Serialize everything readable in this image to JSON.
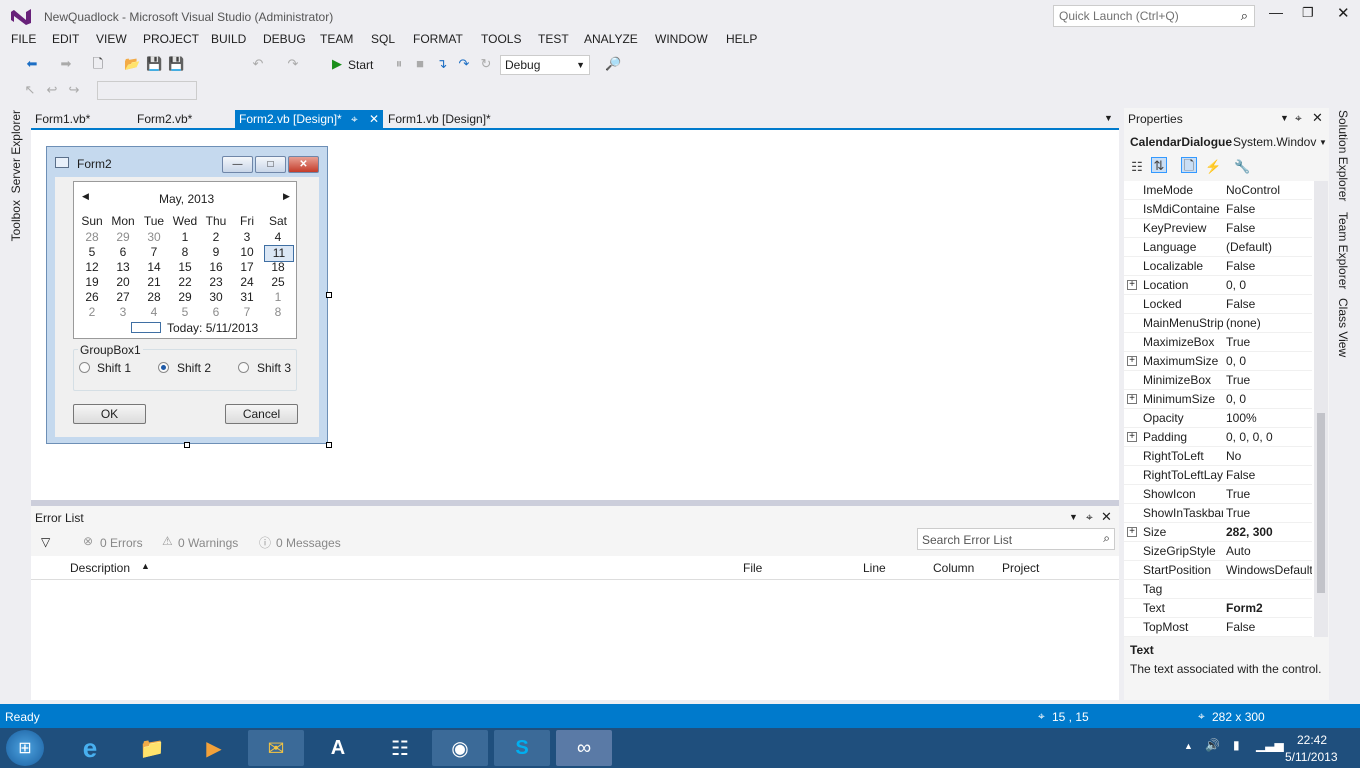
{
  "window": {
    "title": "NewQuadlock - Microsoft Visual Studio (Administrator)",
    "quick_launch_placeholder": "Quick Launch (Ctrl+Q)"
  },
  "menu": [
    "FILE",
    "EDIT",
    "VIEW",
    "PROJECT",
    "BUILD",
    "DEBUG",
    "TEAM",
    "SQL",
    "FORMAT",
    "TOOLS",
    "TEST",
    "ANALYZE",
    "WINDOW",
    "HELP"
  ],
  "toolbar": {
    "start_label": "Start",
    "config": "Debug"
  },
  "side_tabs": {
    "left": [
      "Server Explorer",
      "Toolbox"
    ],
    "right": [
      "Solution Explorer",
      "Team Explorer",
      "Class View"
    ]
  },
  "doc_tabs": [
    "Form1.vb*",
    "Form2.vb*",
    "Form2.vb [Design]*",
    "Form1.vb [Design]*"
  ],
  "form": {
    "title": "Form2",
    "calendar": {
      "month_label": "May, 2013",
      "day_headers": [
        "Sun",
        "Mon",
        "Tue",
        "Wed",
        "Thu",
        "Fri",
        "Sat"
      ],
      "weeks": [
        [
          "28",
          "29",
          "30",
          "1",
          "2",
          "3",
          "4"
        ],
        [
          "5",
          "6",
          "7",
          "8",
          "9",
          "10",
          "11"
        ],
        [
          "12",
          "13",
          "14",
          "15",
          "16",
          "17",
          "18"
        ],
        [
          "19",
          "20",
          "21",
          "22",
          "23",
          "24",
          "25"
        ],
        [
          "26",
          "27",
          "28",
          "29",
          "30",
          "31",
          "1"
        ],
        [
          "2",
          "3",
          "4",
          "5",
          "6",
          "7",
          "8"
        ]
      ],
      "today_label": "Today: 5/11/2013"
    },
    "groupbox": {
      "title": "GroupBox1",
      "options": [
        "Shift 1",
        "Shift 2",
        "Shift 3"
      ],
      "selected": "Shift 2"
    },
    "ok_label": "OK",
    "cancel_label": "Cancel"
  },
  "error_list": {
    "title": "Error List",
    "errors": "0 Errors",
    "warnings": "0 Warnings",
    "messages": "0 Messages",
    "search_placeholder": "Search Error List",
    "columns": [
      "Description",
      "File",
      "Line",
      "Column",
      "Project"
    ]
  },
  "properties": {
    "title": "Properties",
    "object": "CalendarDialogue",
    "type": "System.Windov",
    "rows": [
      {
        "name": "ImeMode",
        "value": "NoControl",
        "expandable": false,
        "bold": false
      },
      {
        "name": "IsMdiContaine",
        "value": "False",
        "expandable": false,
        "bold": false
      },
      {
        "name": "KeyPreview",
        "value": "False",
        "expandable": false,
        "bold": false
      },
      {
        "name": "Language",
        "value": "(Default)",
        "expandable": false,
        "bold": false
      },
      {
        "name": "Localizable",
        "value": "False",
        "expandable": false,
        "bold": false
      },
      {
        "name": "Location",
        "value": "0, 0",
        "expandable": true,
        "bold": false
      },
      {
        "name": "Locked",
        "value": "False",
        "expandable": false,
        "bold": false
      },
      {
        "name": "MainMenuStrip",
        "value": "(none)",
        "expandable": false,
        "bold": false
      },
      {
        "name": "MaximizeBox",
        "value": "True",
        "expandable": false,
        "bold": false
      },
      {
        "name": "MaximumSize",
        "value": "0, 0",
        "expandable": true,
        "bold": false
      },
      {
        "name": "MinimizeBox",
        "value": "True",
        "expandable": false,
        "bold": false
      },
      {
        "name": "MinimumSize",
        "value": "0, 0",
        "expandable": true,
        "bold": false
      },
      {
        "name": "Opacity",
        "value": "100%",
        "expandable": false,
        "bold": false
      },
      {
        "name": "Padding",
        "value": "0, 0, 0, 0",
        "expandable": true,
        "bold": false
      },
      {
        "name": "RightToLeft",
        "value": "No",
        "expandable": false,
        "bold": false
      },
      {
        "name": "RightToLeftLay",
        "value": "False",
        "expandable": false,
        "bold": false
      },
      {
        "name": "ShowIcon",
        "value": "True",
        "expandable": false,
        "bold": false
      },
      {
        "name": "ShowInTaskbar",
        "value": "True",
        "expandable": false,
        "bold": false
      },
      {
        "name": "Size",
        "value": "282, 300",
        "expandable": true,
        "bold": true
      },
      {
        "name": "SizeGripStyle",
        "value": "Auto",
        "expandable": false,
        "bold": false
      },
      {
        "name": "StartPosition",
        "value": "WindowsDefault",
        "expandable": false,
        "bold": false
      },
      {
        "name": "Tag",
        "value": "",
        "expandable": false,
        "bold": false
      },
      {
        "name": "Text",
        "value": "Form2",
        "expandable": false,
        "bold": true
      },
      {
        "name": "TopMost",
        "value": "False",
        "expandable": false,
        "bold": false
      }
    ],
    "desc_title": "Text",
    "desc_text": "The text associated with the control."
  },
  "status": {
    "text": "Ready",
    "position": "15 , 15",
    "size": "282 x 300"
  },
  "clock": {
    "time": "22:42",
    "date": "5/11/2013"
  }
}
